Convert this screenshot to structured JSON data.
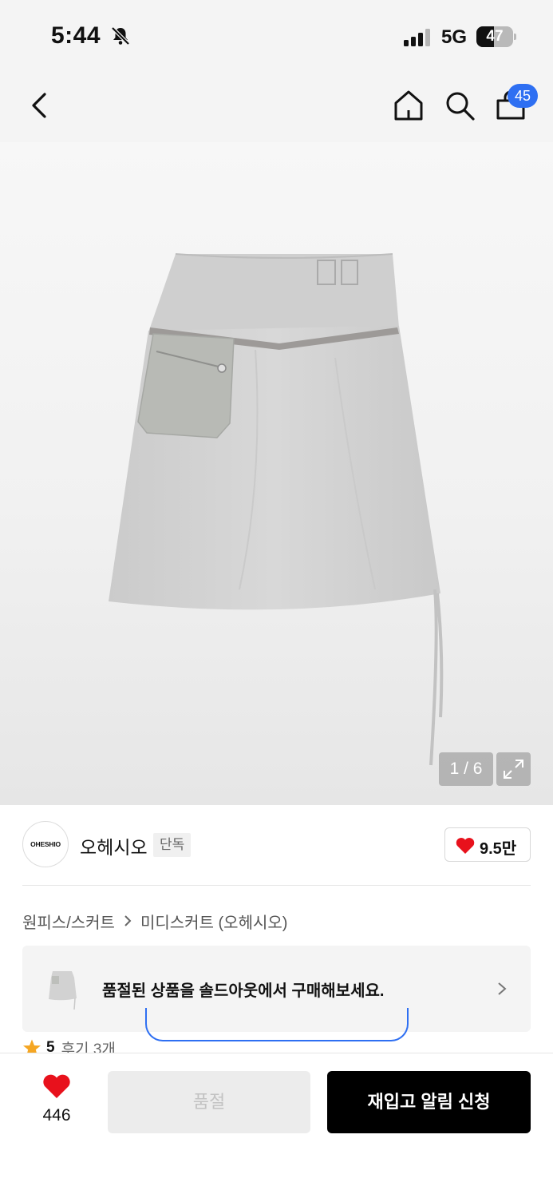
{
  "status_bar": {
    "time": "5:44",
    "network": "5G",
    "battery": "47",
    "battery_level": 0.47
  },
  "nav": {
    "icons": [
      "back-icon",
      "home-icon",
      "search-icon",
      "cart-icon"
    ],
    "cart_badge": "45",
    "badge_color": "#2e6ff2"
  },
  "gallery": {
    "page_indicator": "1 / 6"
  },
  "brand": {
    "logo_text": "OHESHIO",
    "name": "오헤시오",
    "tag": "단독",
    "like_count": "9.5만"
  },
  "breadcrumb": {
    "category": "원피스/스커트",
    "subcategory": "미디스커트 (오헤시오)"
  },
  "soldout_banner": {
    "text": "품절된 상품을 솔드아웃에서 구매해보세요."
  },
  "rating": {
    "score": "5",
    "reviews": "후기 3개"
  },
  "bottom_bar": {
    "wish_count": "446",
    "soldout_label": "품절",
    "restock_label": "재입고 알림 신청"
  },
  "colors": {
    "heart": "#e8111c",
    "star": "#f5a623",
    "primary_button": "#000000"
  }
}
